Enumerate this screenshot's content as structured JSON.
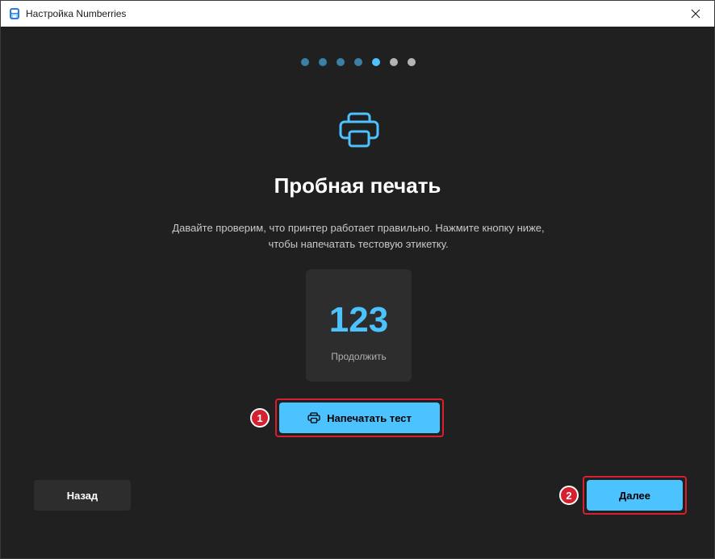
{
  "window": {
    "title": "Настройка Numberries",
    "close_icon": "close-icon",
    "app_icon": "printer-app-icon"
  },
  "progress": {
    "total_steps": 7,
    "current_step": 5,
    "colors": {
      "completed": "#3b7ea6",
      "current": "#4cc2ff",
      "upcoming": "#b4b4b4"
    }
  },
  "main": {
    "icon": "printer-icon",
    "heading": "Пробная печать",
    "description": "Давайте проверим, что принтер работает правильно. Нажмите кнопку ниже, чтобы напечатать тестовую этикетку.",
    "preview": {
      "number": "123",
      "label": "Продолжить"
    },
    "print_button": {
      "icon": "printer-icon",
      "label": "Напечатать тест",
      "annotation": "1"
    }
  },
  "footer": {
    "back_label": "Назад",
    "next_label": "Далее",
    "next_annotation": "2"
  },
  "colors": {
    "accent": "#4cc2ff",
    "background": "#202020",
    "card": "#2d2d2d",
    "annotation": "#d4202f"
  }
}
